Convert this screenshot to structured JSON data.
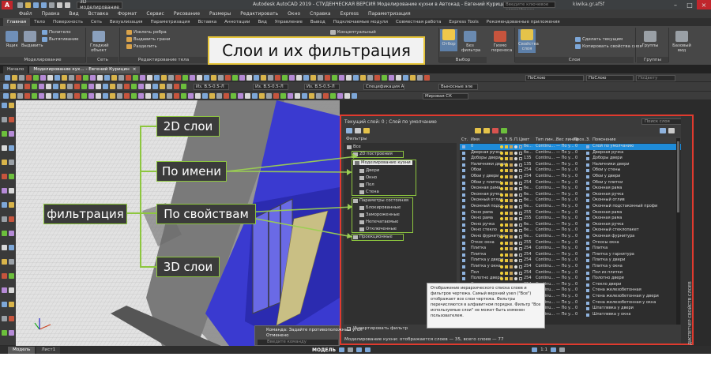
{
  "titlebar": {
    "app_letter": "A",
    "workspace": "3D моделирование",
    "title": "Autodesk AutoCAD 2019 - СТУДЕНЧЕСКАЯ ВЕРСИЯ   Моделирование кухни в Автокад - Евгений Курицин.dwg",
    "search_placeholder": "Введите ключевое слово/фразу",
    "user": "kiwika.gr.af5f"
  },
  "menubar": [
    "Файл",
    "Правка",
    "Вид",
    "Вставка",
    "Формат",
    "Сервис",
    "Рисование",
    "Размеры",
    "Редактировать",
    "Окно",
    "Справка",
    "Express",
    "Параметризация"
  ],
  "ribbon_tabs": [
    {
      "label": "Главная",
      "active": true
    },
    {
      "label": "Тело"
    },
    {
      "label": "Поверхность"
    },
    {
      "label": "Сеть"
    },
    {
      "label": "Визуализация"
    },
    {
      "label": "Параметризация"
    },
    {
      "label": "Вставка"
    },
    {
      "label": "Аннотации"
    },
    {
      "label": "Вид"
    },
    {
      "label": "Управление"
    },
    {
      "label": "Вывод"
    },
    {
      "label": "Подключаемые модули"
    },
    {
      "label": "Совместная работа"
    },
    {
      "label": "Express Tools"
    },
    {
      "label": "Рекомендованные приложения"
    }
  ],
  "ribbon": {
    "box": "Ящик",
    "extrude": "Выдавить",
    "smooth_object": "Гладкий объект",
    "polysolid": "Политело",
    "presspull": "Вытягивание",
    "group_modeling": "Моделирование",
    "group_mesh": "Сеть",
    "extract_edges": "Извлечь ребра",
    "extrude_faces": "Выдавить грани",
    "separate": "Разделить",
    "group_solid_edit": "Редактирование тела",
    "conceptual": "Концептуальный",
    "section": "Отбор",
    "no_filter": "Без фильтра",
    "group_selection": "Выбор",
    "gizmo": "Гизмо переноса",
    "layer_props": "Свойства слоя",
    "make_current": "Сделать текущим",
    "copy_layer_props": "Копировать свойства слоя",
    "group_layers": "Слои",
    "groups": "Группы",
    "base_view": "Базовый вид",
    "group_groups": "Группы"
  },
  "doctabs": [
    {
      "label": "Начало"
    },
    {
      "label": "Моделирование кух... - Евгений Курицин",
      "active": true
    }
  ],
  "toolbar": {
    "layer_field": "ПоСлою",
    "linetype_field": "ПоСлою",
    "lineweight_field": "ПоСлою",
    "plot_field": "ПоЦвету",
    "text_style_a": "Из. В.5-0.5-Л",
    "text_style_b": "Из. В.5-0.5-Л",
    "text_style_c": "Из. В.5-0.5-Л",
    "spec": "Спецификация А",
    "leader": "Выносные эле",
    "ucs": "Мировая СК"
  },
  "title_callout": "Слои и их фильтрация",
  "callouts": {
    "filter": "фильтрация",
    "layers2d": "2D слои",
    "by_name": "По имени",
    "by_props": "По свойствам",
    "layers3d": "3D слои"
  },
  "layer_manager": {
    "current_layer": "Текущий слой: 0 ; Слой по умолчанию",
    "search_placeholder": "Поиск слоя",
    "filters_title": "Фильтры",
    "tree": {
      "all": "Все",
      "g2d": "2D построения",
      "modeling": "Моделирование кухни",
      "doors": "Двери",
      "window": "Окно",
      "floor": "Пол",
      "wall": "Стена",
      "state_params": "Параметры состояния",
      "locked": "Блокированные",
      "frozen": "Замороженные",
      "nonprint": "Непечатаемые",
      "off": "Отключенные",
      "projection": "Проекционные"
    },
    "invert_filter": "Инвертировать фильтр",
    "status": "Моделирование кухни: отображается слоев — 35, всего слоев — 77",
    "side_tab": "ДИСПЕТЧЕР СВОЙСТВ СЛОЕВ",
    "columns": [
      "Ст.",
      "Имя",
      "В.",
      "З.",
      "Б.",
      "П.",
      "Цвет",
      "Тип лин...",
      "Вес линий",
      "Проз...",
      "З.",
      "Пояснение"
    ],
    "rows": [
      {
        "name": "0",
        "color": "бе...",
        "ltype": "Continu...",
        "lw": "— По у...",
        "tr": "0",
        "desc": "Слой по умолчанию",
        "sel": true
      },
      {
        "name": "Дверная ручка",
        "color": "бе...",
        "ltype": "Continu...",
        "lw": "— По у...",
        "tr": "0",
        "desc": "Дверная ручка"
      },
      {
        "name": "Доборы двери",
        "color": "135",
        "ltype": "Continu...",
        "lw": "— По у...",
        "tr": "0",
        "desc": "Доборы двери"
      },
      {
        "name": "Наличники двери",
        "color": "135",
        "ltype": "Continu...",
        "lw": "— По у...",
        "tr": "0",
        "desc": "Наличники двери"
      },
      {
        "name": "Обои",
        "color": "254",
        "ltype": "Continu...",
        "lw": "— По у...",
        "tr": "0",
        "desc": "Обои у стены"
      },
      {
        "name": "Обои у двери",
        "color": "254",
        "ltype": "Continu...",
        "lw": "— По у...",
        "tr": "0",
        "desc": "Обои у двери"
      },
      {
        "name": "Обои у плитки",
        "color": "254",
        "ltype": "Continu...",
        "lw": "— По у...",
        "tr": "0",
        "desc": "Обои у плитки"
      },
      {
        "name": "Оконная рама",
        "color": "бе...",
        "ltype": "Continu...",
        "lw": "— По у...",
        "tr": "0",
        "desc": "Оконная рама"
      },
      {
        "name": "Оконная ручка",
        "color": "бе...",
        "ltype": "Continu...",
        "lw": "— По у...",
        "tr": "0",
        "desc": "Оконная ручка"
      },
      {
        "name": "Оконный отлив",
        "color": "бе...",
        "ltype": "Continu...",
        "lw": "— По у...",
        "tr": "0",
        "desc": "Оконный отлив"
      },
      {
        "name": "Оконный подст.",
        "color": "бе...",
        "ltype": "Continu...",
        "lw": "— По у...",
        "tr": "0",
        "desc": "Оконный подстаконный профи"
      },
      {
        "name": "Окно рама",
        "color": "255",
        "ltype": "Continu...",
        "lw": "— По у...",
        "tr": "0",
        "desc": "Оконная рама"
      },
      {
        "name": "Окно рама",
        "color": "255",
        "ltype": "Continu...",
        "lw": "— По у...",
        "tr": "0",
        "desc": "Оконная рама"
      },
      {
        "name": "Окно ручка",
        "color": "бе...",
        "ltype": "Continu...",
        "lw": "— По у...",
        "tr": "0",
        "desc": "Оконная ручка"
      },
      {
        "name": "Окно стекло",
        "color": "бе...",
        "ltype": "Continu...",
        "lw": "— По у...",
        "tr": "0",
        "desc": "Оконный стеклопакет"
      },
      {
        "name": "Окно фурнитура",
        "color": "бе...",
        "ltype": "Continu...",
        "lw": "— По у...",
        "tr": "0",
        "desc": "Оконная фурнитура"
      },
      {
        "name": "Откос окна",
        "color": "255",
        "ltype": "Continu...",
        "lw": "— По у...",
        "tr": "0",
        "desc": "Откосы окна"
      },
      {
        "name": "Плитка",
        "color": "254",
        "ltype": "Continu...",
        "lw": "— По у...",
        "tr": "0",
        "desc": "Плитка"
      },
      {
        "name": "Плитка",
        "color": "254",
        "ltype": "Continu...",
        "lw": "— По у...",
        "tr": "0",
        "desc": "Плитка у гарнитура"
      },
      {
        "name": "Плитка у двери",
        "color": "254",
        "ltype": "Continu...",
        "lw": "— По у...",
        "tr": "0",
        "desc": "Плитка у двери"
      },
      {
        "name": "Плитка у окна",
        "color": "254",
        "ltype": "Continu...",
        "lw": "— По у...",
        "tr": "0",
        "desc": "Плитка у окна"
      },
      {
        "name": "Пол",
        "color": "254",
        "ltype": "Continu...",
        "lw": "— По у...",
        "tr": "0",
        "desc": "Пол из плитки"
      },
      {
        "name": "Полотно двери",
        "color": "254",
        "ltype": "Continu...",
        "lw": "— По у...",
        "tr": "0",
        "desc": "Полотно двери"
      },
      {
        "name": "Стекло двери",
        "color": "254",
        "ltype": "Continu...",
        "lw": "— По у...",
        "tr": "0",
        "desc": "Стекло двери"
      },
      {
        "name": "Стена",
        "color": "250",
        "ltype": "Continu...",
        "lw": "— По у...",
        "tr": "0",
        "desc": "Стена железобетонная"
      },
      {
        "name": "Стена жб",
        "color": "250",
        "ltype": "Continu...",
        "lw": "— По у...",
        "tr": "0",
        "desc": "Стена железобетонная у двери"
      },
      {
        "name": "Стена жб",
        "color": "250",
        "ltype": "Continu...",
        "lw": "— По у...",
        "tr": "0",
        "desc": "Стена железобетонная у окна"
      },
      {
        "name": "Шпатлевка",
        "color": "250",
        "ltype": "Continu...",
        "lw": "— По у...",
        "tr": "0",
        "desc": "Шпатлевка у двери"
      },
      {
        "name": "Шпатлевка",
        "color": "250",
        "ltype": "Continu...",
        "lw": "— По у...",
        "tr": "0",
        "desc": "Шпатлевка у окна"
      }
    ],
    "tooltip": "Отображение иерархического списка слоев и фильтров чертежа. Самый верхний узел (\"Все\") отображает все слои чертежа. Фильтры перечисляются в алфавитном порядке. Фильтр \"Все используемые слои\" не может быть изменен пользователем."
  },
  "cmdline": {
    "line1": "Команда: Задайте противоположный угол",
    "line2": "Отменено",
    "placeholder": "Введите команду"
  },
  "layout_tabs": [
    {
      "label": "Модель",
      "active": true
    },
    {
      "label": "Лист1"
    }
  ],
  "status": {
    "model": "МОДЕЛЬ",
    "scale": "1:1"
  }
}
